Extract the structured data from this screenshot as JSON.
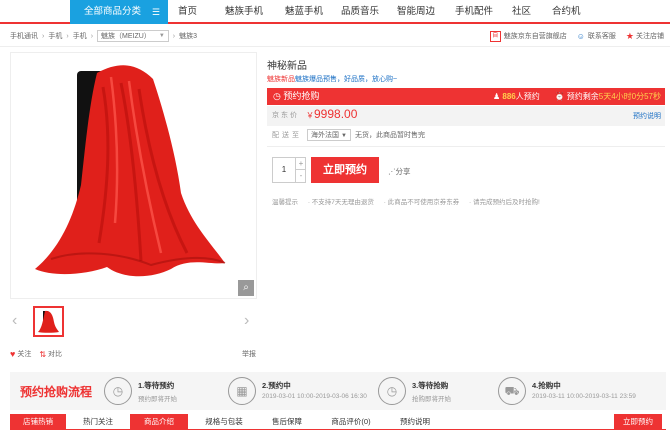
{
  "nav": {
    "all_categories": "全部商品分类",
    "items": [
      "首页",
      "魅族手机",
      "魅蓝手机",
      "品质音乐",
      "智能周边",
      "手机配件",
      "社区",
      "合约机"
    ]
  },
  "breadcrumb": {
    "items": [
      "手机通讯",
      "手机",
      "手机"
    ],
    "brand": "魅族（MEIZU）",
    "product": "魅族3"
  },
  "shop": {
    "name": "魅族京东自营旗舰店",
    "contact": "联系客服",
    "follow": "关注店铺"
  },
  "gallery": {
    "follow": "关注",
    "compare": "对比",
    "report": "举报"
  },
  "product": {
    "title": "神秘新品",
    "promo_prefix": "魅族新品",
    "promo_link": "魅族爆品预售，好品质，放心购~"
  },
  "reserve_bar": {
    "label": "预约抢购",
    "count": "886",
    "count_suffix": "人预约",
    "remaining_label": "预约剩余",
    "remaining_value": "5天4小时0分57秒"
  },
  "price": {
    "label": "京东价",
    "currency": "￥",
    "value": "9998.00",
    "explain": "预约说明"
  },
  "delivery": {
    "label": "配送至",
    "region": "海外法国",
    "stock": "无货，此商品暂时售完"
  },
  "purchase": {
    "quantity": "1",
    "plus": "+",
    "minus": "-",
    "reserve_button": "立即预约",
    "share": "分享"
  },
  "tips": {
    "label": "温馨提示",
    "items": [
      "· 不支持7天无理由退货",
      "· 此商品不可使用京券东券",
      "· 请完成预约后及时抢购!"
    ]
  },
  "flow": {
    "title": "预约抢购流程",
    "steps": [
      {
        "title": "1.等待预约",
        "desc": "预约即将开始",
        "icon": "clock-icon"
      },
      {
        "title": "2.预约中",
        "desc": "2019-03-01 10:00-2019-03-06 16:30",
        "icon": "calendar-icon"
      },
      {
        "title": "3.等待抢购",
        "desc": "抢购即将开始",
        "icon": "clock-icon"
      },
      {
        "title": "4.抢购中",
        "desc": "2019-03-11 10:00-2019-03-11 23:59",
        "icon": "cart-icon"
      }
    ]
  },
  "tabs": {
    "shop_tab": "店铺热销",
    "hot_tab": "热门关注",
    "items": [
      "商品介绍",
      "规格与包装",
      "售后保障",
      "商品评价(0)",
      "预约说明"
    ],
    "right_button": "立即预约"
  },
  "colors": {
    "accent": "#e33333",
    "nav_blue": "#1aa1e0",
    "link": "#1a6fc4"
  }
}
